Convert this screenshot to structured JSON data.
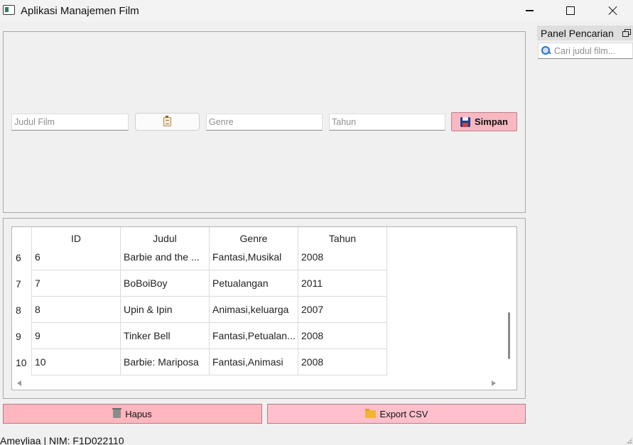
{
  "window": {
    "title": "Aplikasi Manajemen Film"
  },
  "form": {
    "judul_placeholder": "Judul Film",
    "genre_placeholder": "Genre",
    "tahun_placeholder": "Tahun",
    "judul_value": "",
    "genre_value": "",
    "tahun_value": "",
    "simpan_label": "Simpan",
    "clip_button_icon": "clipboard-icon"
  },
  "table": {
    "columns": [
      "ID",
      "Judul",
      "Genre",
      "Tahun"
    ],
    "rows": [
      {
        "row": "6",
        "id": "6",
        "judul": "Barbie and the ...",
        "genre": "Fantasi,Musikal",
        "tahun": "2008"
      },
      {
        "row": "7",
        "id": "7",
        "judul": "BoBoiBoy",
        "genre": "Petualangan",
        "tahun": "2011"
      },
      {
        "row": "8",
        "id": "8",
        "judul": "Upin & Ipin",
        "genre": "Animasi,keluarga",
        "tahun": "2007"
      },
      {
        "row": "9",
        "id": "9",
        "judul": "Tinker Bell",
        "genre": "Fantasi,Petualan...",
        "tahun": "2008"
      },
      {
        "row": "10",
        "id": "10",
        "judul": "Barbie: Mariposa",
        "genre": "Fantasi,Animasi",
        "tahun": "2008"
      }
    ]
  },
  "actions": {
    "hapus_label": "Hapus",
    "export_label": "Export CSV"
  },
  "status": {
    "text": "Ameyliaa | NIM: F1D022110"
  },
  "dock": {
    "title": "Panel Pencarian",
    "search_placeholder": "Cari judul film...",
    "search_value": ""
  },
  "colors": {
    "simpan_bg": "#f7b8c1",
    "hapus_bg": "#ffb6bf",
    "export_bg": "#ffc0cc",
    "window_bg": "#f0f0f0"
  }
}
